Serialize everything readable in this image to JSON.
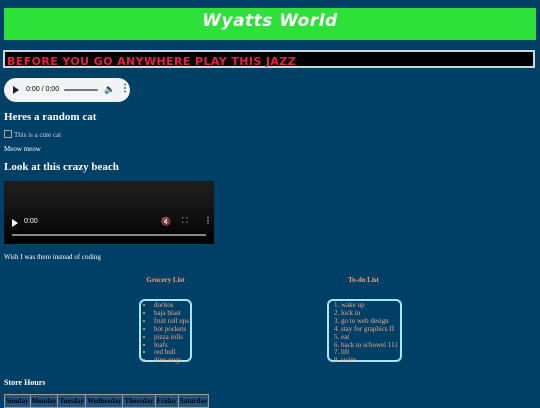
{
  "header": {
    "title": "Wyatts World"
  },
  "banner": {
    "text": "BEFORE YOU GO ANYWHERE PLAY THIS JAZZ"
  },
  "audio": {
    "time": "0:00 / 0:00"
  },
  "cat": {
    "heading": "Heres a random cat",
    "alt": "This is a cute cat",
    "caption": "Meow meow"
  },
  "beach": {
    "heading": "Look at this crazy beach",
    "time": "0:00",
    "caption": "Wish I was there instead of coding"
  },
  "grocery": {
    "title": "Grocery List",
    "items": [
      "doritos",
      "baja blast",
      "fruit roll ups",
      "hot pockets",
      "pizza rolls",
      "loafs",
      "red bull",
      "dino nugs"
    ]
  },
  "todo": {
    "title": "To-do List",
    "items": [
      "wake up",
      "lock in",
      "go to web design",
      "stay for graphics II",
      "eat",
      "back to schowel 111",
      "lift",
      "swim"
    ]
  },
  "hours": {
    "heading": "Store Hours",
    "days": [
      "Sunday",
      "Monday",
      "Tuesday",
      "Wednesday",
      "Thursday",
      "Friday",
      "Saturday"
    ]
  },
  "colors": {
    "background": "#003f66",
    "header": "#2ee03a",
    "banner_text": "#e8243c",
    "list_text": "#f0a98a",
    "list_border": "#a7e8f0"
  }
}
